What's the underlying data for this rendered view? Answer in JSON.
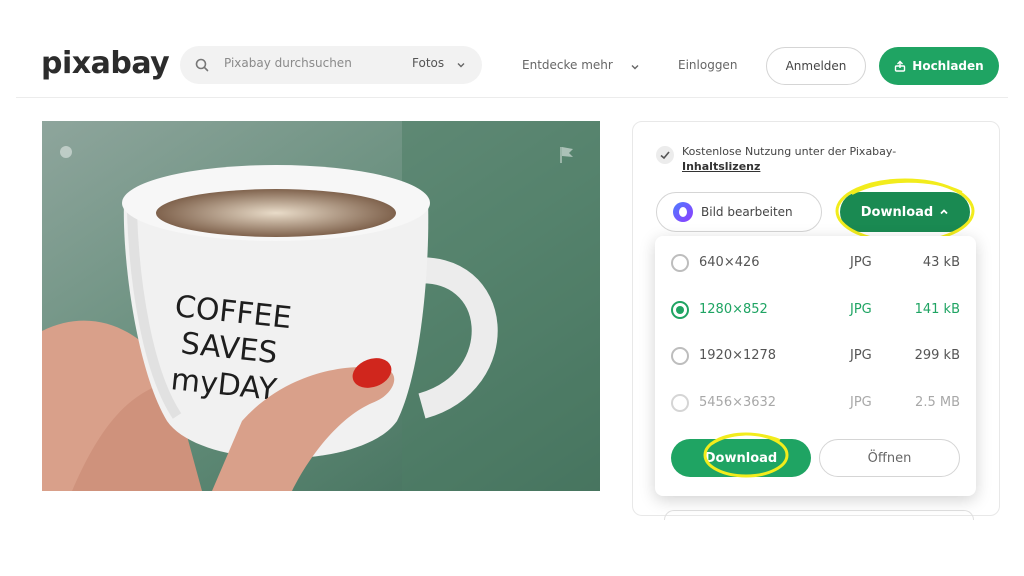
{
  "header": {
    "logo": "pixabay",
    "search_placeholder": "Pixabay durchsuchen",
    "search_type": "Fotos",
    "nav_discover": "Entdecke mehr",
    "nav_login": "Einloggen",
    "register_label": "Anmelden",
    "upload_label": "Hochladen"
  },
  "photo": {
    "mug_text": [
      "COFFEE",
      "SAVES",
      "myDAY"
    ]
  },
  "panel": {
    "license_text": "Kostenlose Nutzung unter der Pixabay-",
    "license_link": "Inhaltslizenz",
    "edit_label": "Bild bearbeiten",
    "download_top_label": "Download"
  },
  "dropdown": {
    "options": [
      {
        "resolution": "640×426",
        "format": "JPG",
        "size": "43 kB"
      },
      {
        "resolution": "1280×852",
        "format": "JPG",
        "size": "141 kB"
      },
      {
        "resolution": "1920×1278",
        "format": "JPG",
        "size": "299 kB"
      },
      {
        "resolution": "5456×3632",
        "format": "JPG",
        "size": "2.5 MB"
      }
    ],
    "selected_index": 1,
    "download_label": "Download",
    "open_label": "Öffnen"
  },
  "colors": {
    "brand_green": "#1fa463",
    "dark_green": "#1a8a52",
    "highlight_yellow": "#f2ec1c"
  },
  "icons": [
    "search-icon",
    "chevron-down-icon",
    "upload-icon",
    "check-icon",
    "chevron-up-icon",
    "flag-icon"
  ]
}
